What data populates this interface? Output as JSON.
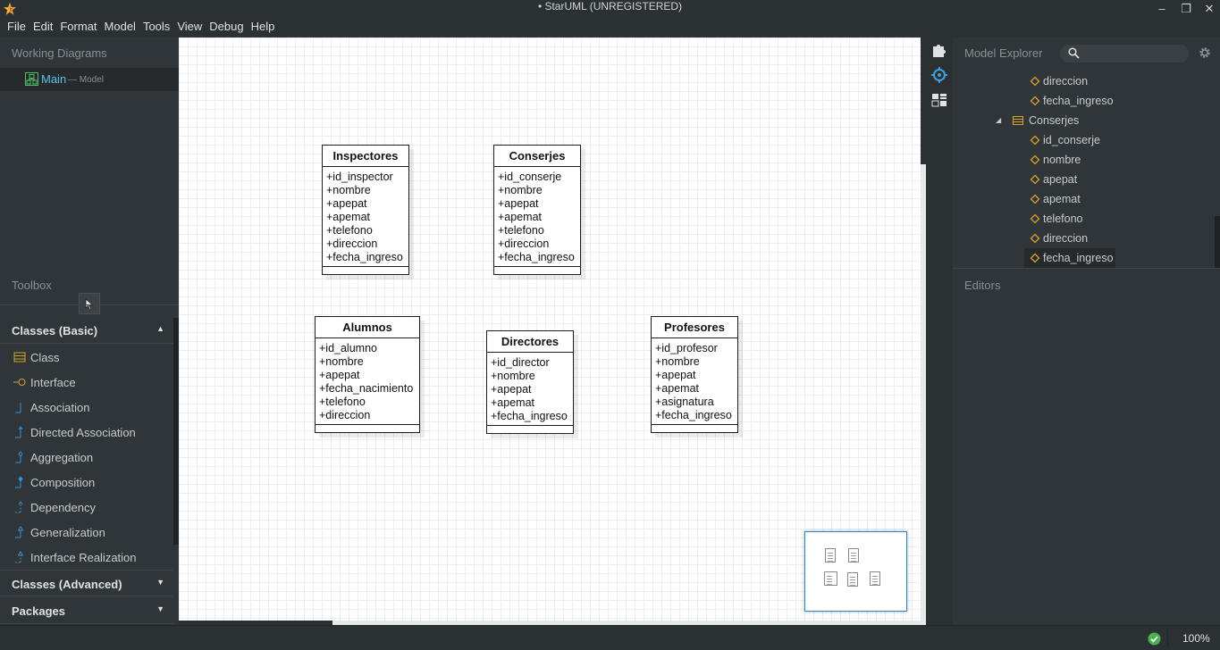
{
  "window": {
    "title": "• StarUML (UNREGISTERED)",
    "minimize": "–",
    "restore": "❐",
    "close": "✕"
  },
  "menu": [
    "File",
    "Edit",
    "Format",
    "Model",
    "Tools",
    "View",
    "Debug",
    "Help"
  ],
  "working_diagrams": {
    "header": "Working Diagrams",
    "items": [
      {
        "label": "Main",
        "sub": "— Model"
      }
    ]
  },
  "toolbox": {
    "header": "Toolbox",
    "sections": [
      {
        "label": "Classes (Basic)",
        "arrow": "▲"
      },
      {
        "label": "Classes (Advanced)",
        "arrow": "▼"
      },
      {
        "label": "Packages",
        "arrow": "▼"
      }
    ],
    "basic_items": [
      {
        "label": "Class",
        "icon": "class-icon"
      },
      {
        "label": "Interface",
        "icon": "interface-icon"
      },
      {
        "label": "Association",
        "icon": "association-icon"
      },
      {
        "label": "Directed Association",
        "icon": "directed-association-icon"
      },
      {
        "label": "Aggregation",
        "icon": "aggregation-icon"
      },
      {
        "label": "Composition",
        "icon": "composition-icon"
      },
      {
        "label": "Dependency",
        "icon": "dependency-icon"
      },
      {
        "label": "Generalization",
        "icon": "generalization-icon"
      },
      {
        "label": "Interface Realization",
        "icon": "interface-realization-icon"
      }
    ]
  },
  "diagram": {
    "classes": [
      {
        "name": "Inspectores",
        "attributes": [
          "+id_inspector",
          "+nombre",
          "+apepat",
          "+apemat",
          "+telefono",
          "+direccion",
          "+fecha_ingreso"
        ]
      },
      {
        "name": "Conserjes",
        "attributes": [
          "+id_conserje",
          "+nombre",
          "+apepat",
          "+apemat",
          "+telefono",
          "+direccion",
          "+fecha_ingreso"
        ]
      },
      {
        "name": "Alumnos",
        "attributes": [
          "+id_alumno",
          "+nombre",
          "+apepat",
          "+fecha_nacimiento",
          "+telefono",
          "+direccion"
        ]
      },
      {
        "name": "Directores",
        "attributes": [
          "+id_director",
          "+nombre",
          "+apepat",
          "+apemat",
          "+fecha_ingreso"
        ]
      },
      {
        "name": "Profesores",
        "attributes": [
          "+id_profesor",
          "+nombre",
          "+apepat",
          "+apemat",
          "+asignatura",
          "+fecha_ingreso"
        ]
      }
    ]
  },
  "model_explorer": {
    "header": "Model Explorer",
    "search_placeholder": "",
    "tree": [
      {
        "label": "direccion",
        "type": "attribute"
      },
      {
        "label": "fecha_ingreso",
        "type": "attribute"
      },
      {
        "label": "Conserjes",
        "type": "class",
        "expanded": true
      },
      {
        "label": "id_conserje",
        "type": "attribute"
      },
      {
        "label": "nombre",
        "type": "attribute"
      },
      {
        "label": "apepat",
        "type": "attribute"
      },
      {
        "label": "apemat",
        "type": "attribute"
      },
      {
        "label": "telefono",
        "type": "attribute"
      },
      {
        "label": "direccion",
        "type": "attribute"
      },
      {
        "label": "fecha_ingreso",
        "type": "attribute",
        "selected": true
      }
    ]
  },
  "editors": {
    "header": "Editors"
  },
  "status": {
    "zoom": "100%",
    "validation": "ok"
  },
  "colors": {
    "accent": "#5cc2ee",
    "attribute_icon": "#d4a52a",
    "class_icon": "#d4a52a",
    "ok_green": "#4caf50"
  }
}
